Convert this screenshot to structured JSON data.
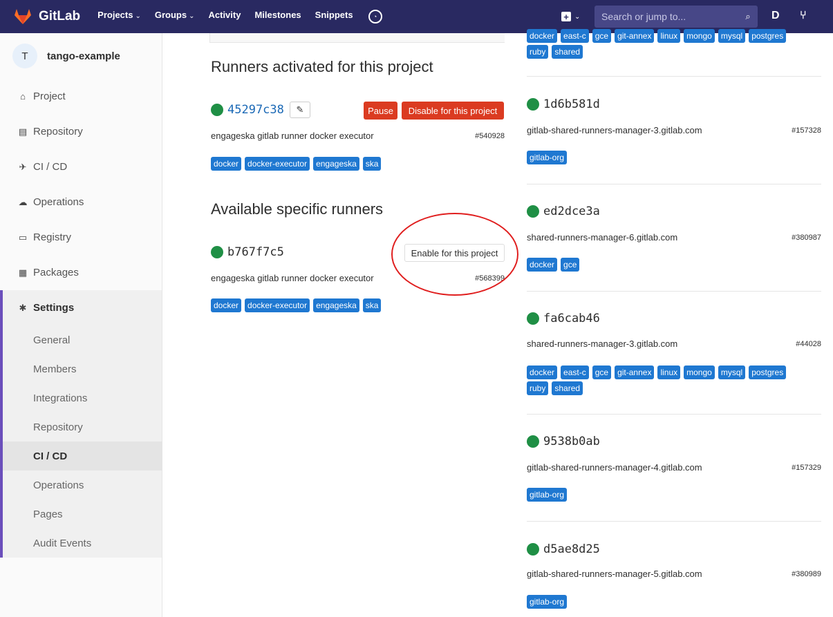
{
  "nav": {
    "brand": "GitLab",
    "links": [
      {
        "label": "Projects",
        "caret": "⌄"
      },
      {
        "label": "Groups",
        "caret": "⌄"
      },
      {
        "label": "Activity",
        "caret": ""
      },
      {
        "label": "Milestones",
        "caret": ""
      },
      {
        "label": "Snippets",
        "caret": ""
      }
    ],
    "search_placeholder": "Search or jump to...",
    "plus_caret": "⌄"
  },
  "sidebar": {
    "avatar_letter": "T",
    "project_name": "tango-example",
    "items": [
      {
        "label": "Project",
        "icon": "home-icon",
        "glyph": "⌂"
      },
      {
        "label": "Repository",
        "icon": "doc-icon",
        "glyph": "▤"
      },
      {
        "label": "CI / CD",
        "icon": "rocket-icon",
        "glyph": "✈"
      },
      {
        "label": "Operations",
        "icon": "cloud-gear-icon",
        "glyph": "☁"
      },
      {
        "label": "Registry",
        "icon": "container-icon",
        "glyph": "▭"
      },
      {
        "label": "Packages",
        "icon": "package-icon",
        "glyph": "▦"
      }
    ],
    "settings": {
      "label": "Settings",
      "glyph": "✱"
    },
    "settings_sub": [
      "General",
      "Members",
      "Integrations",
      "Repository",
      "CI / CD",
      "Operations",
      "Pages",
      "Audit Events"
    ],
    "active_sub": "CI / CD"
  },
  "activated": {
    "title": "Runners activated for this project",
    "runner": {
      "token": "45297c38",
      "description": "engageska gitlab runner docker executor",
      "id": "#540928",
      "tags": [
        "docker",
        "docker-executor",
        "engageska",
        "ska"
      ],
      "pause_label": "Pause",
      "disable_label": "Disable for this project"
    }
  },
  "available": {
    "title": "Available specific runners",
    "runner": {
      "token": "b767f7c5",
      "description": "engageska gitlab runner docker executor",
      "id": "#568399",
      "tags": [
        "docker",
        "docker-executor",
        "engageska",
        "ska"
      ],
      "enable_label": "Enable for this project"
    }
  },
  "shared": {
    "top_tags": [
      "docker",
      "east-c",
      "gce",
      "git-annex",
      "linux",
      "mongo",
      "mysql",
      "postgres",
      "ruby",
      "shared"
    ],
    "runners": [
      {
        "token": "1d6b581d",
        "description": "gitlab-shared-runners-manager-3.gitlab.com",
        "id": "#157328",
        "tags": [
          "gitlab-org"
        ]
      },
      {
        "token": "ed2dce3a",
        "description": "shared-runners-manager-6.gitlab.com",
        "id": "#380987",
        "tags": [
          "docker",
          "gce"
        ]
      },
      {
        "token": "fa6cab46",
        "description": "shared-runners-manager-3.gitlab.com",
        "id": "#44028",
        "tags": [
          "docker",
          "east-c",
          "gce",
          "git-annex",
          "linux",
          "mongo",
          "mysql",
          "postgres",
          "ruby",
          "shared"
        ]
      },
      {
        "token": "9538b0ab",
        "description": "gitlab-shared-runners-manager-4.gitlab.com",
        "id": "#157329",
        "tags": [
          "gitlab-org"
        ]
      },
      {
        "token": "d5ae8d25",
        "description": "gitlab-shared-runners-manager-5.gitlab.com",
        "id": "#380989",
        "tags": [
          "gitlab-org"
        ]
      }
    ]
  },
  "colors": {
    "nav_bg": "#292961",
    "tag_bg": "#1f78d1",
    "danger": "#db3b21",
    "status_online": "#1f8f45",
    "highlight": "#e01e1e"
  }
}
